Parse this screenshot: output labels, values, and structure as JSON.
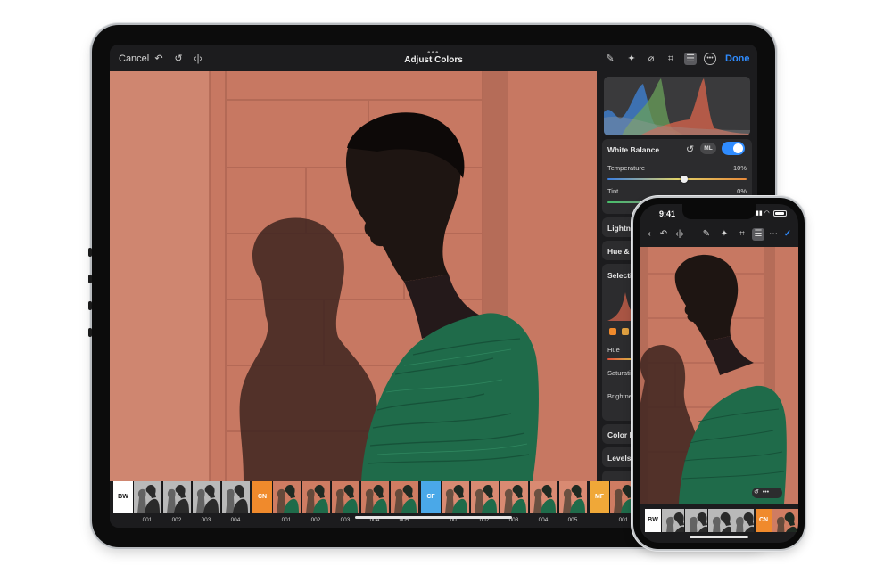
{
  "ipad": {
    "toolbar": {
      "cancel_label": "Cancel",
      "title": "Adjust Colors",
      "done_label": "Done",
      "icons": [
        "undo-icon",
        "redo-icon",
        "compare-icon",
        "pen-icon",
        "retouch-icon",
        "brush-icon",
        "crop-icon",
        "adjust-icon",
        "more-icon"
      ]
    },
    "panel": {
      "white_balance": {
        "title": "White Balance",
        "ml_label": "ML",
        "enabled": true,
        "temperature_label": "Temperature",
        "temperature_value": "10%",
        "tint_label": "Tint",
        "tint_value": "0%"
      },
      "sections": [
        "Lightness",
        "Hue & Saturation",
        "Selective",
        "Color Balance",
        "Levels"
      ],
      "selective_labels": {
        "hue": "Hue",
        "saturation": "Saturation",
        "brightness": "Brightness"
      }
    },
    "filmstrip": {
      "groups": [
        {
          "tag": "BW",
          "color": "#ffffff",
          "text": "#111111",
          "items": [
            "001",
            "002",
            "003",
            "004"
          ]
        },
        {
          "tag": "CN",
          "color": "#f08a2c",
          "text": "#ffffff",
          "items": [
            "001",
            "002",
            "003",
            "004",
            "005"
          ]
        },
        {
          "tag": "CF",
          "color": "#4aa8e8",
          "text": "#ffffff",
          "items": [
            "001",
            "002",
            "003",
            "004",
            "005"
          ]
        },
        {
          "tag": "MF",
          "color": "#f0a838",
          "text": "#ffffff",
          "items": [
            "001"
          ]
        }
      ]
    }
  },
  "iphone": {
    "time": "9:41",
    "filmstrip_tags": [
      {
        "tag": "BW",
        "color": "#ffffff",
        "text": "#111111"
      },
      {
        "tag": "CN",
        "color": "#f08a2c",
        "text": "#ffffff"
      }
    ],
    "icons": [
      "back-icon",
      "undo-icon",
      "compare-icon",
      "pen-icon",
      "crop-icon",
      "adjust-icon",
      "more-icon",
      "checkmark-icon"
    ]
  },
  "colors": {
    "accent": "#2f8cff",
    "wall": "#c97a64",
    "dress": "#1f6b4a"
  }
}
